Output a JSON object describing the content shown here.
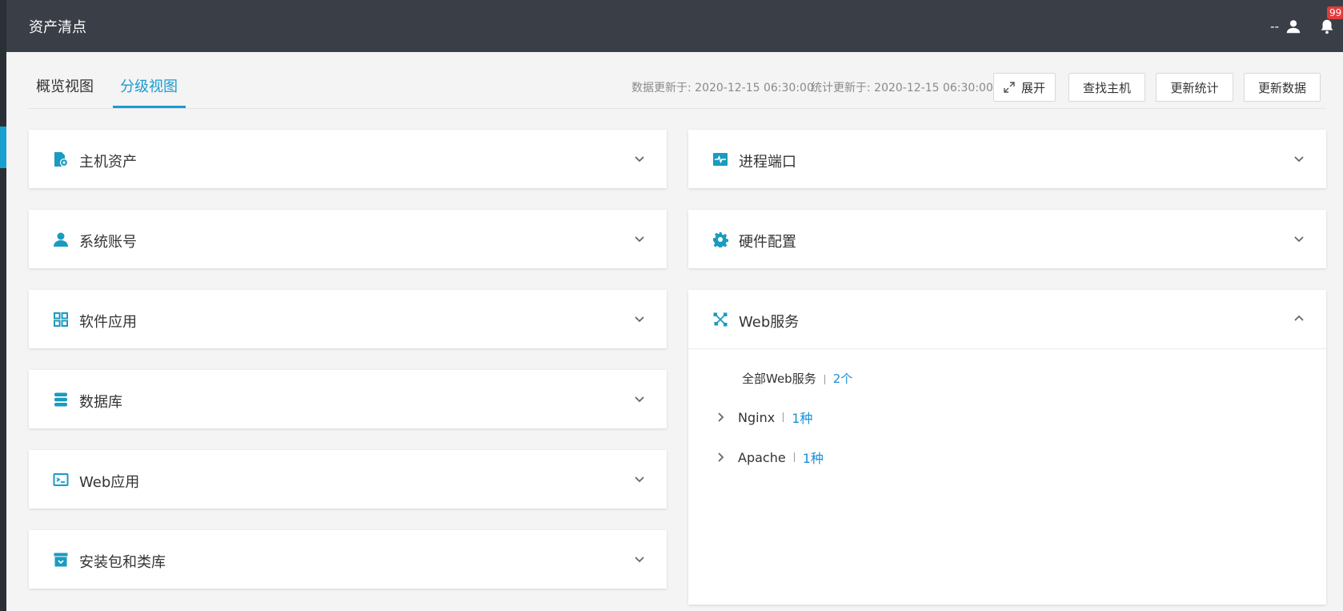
{
  "app": {
    "title": "资产清点"
  },
  "header": {
    "user_name": "--",
    "notification_count": "99"
  },
  "tabs": [
    {
      "label": "概览视图",
      "active": false
    },
    {
      "label": "分级视图",
      "active": true
    }
  ],
  "meta": {
    "data_updated": "数据更新于: 2020-12-15 06:30:00",
    "stats_updated": "统计更新于: 2020-12-15 06:30:00"
  },
  "buttons": {
    "expand": "展开",
    "find_host": "查找主机",
    "update_stats": "更新统计",
    "update_data": "更新数据"
  },
  "left_cards": [
    {
      "title": "主机资产",
      "icon": "host-asset-icon"
    },
    {
      "title": "系统账号",
      "icon": "user-icon"
    },
    {
      "title": "软件应用",
      "icon": "grid-apps-icon"
    },
    {
      "title": "数据库",
      "icon": "database-icon"
    },
    {
      "title": "Web应用",
      "icon": "web-app-icon"
    },
    {
      "title": "安装包和类库",
      "icon": "package-icon"
    }
  ],
  "right_cards": [
    {
      "title": "进程端口",
      "icon": "process-port-icon"
    },
    {
      "title": "硬件配置",
      "icon": "gear-icon"
    },
    {
      "title": "Web服务",
      "icon": "web-service-icon",
      "expanded": true
    }
  ],
  "web_service": {
    "summary_label": "全部Web服务",
    "summary_count": "2个",
    "items": [
      {
        "name": "Nginx",
        "count": "1种"
      },
      {
        "name": "Apache",
        "count": "1种"
      }
    ]
  },
  "colors": {
    "accent": "#1a9bd1",
    "link": "#1a8fd8",
    "topbar": "#3a3f47",
    "badge": "#e23b3b"
  }
}
